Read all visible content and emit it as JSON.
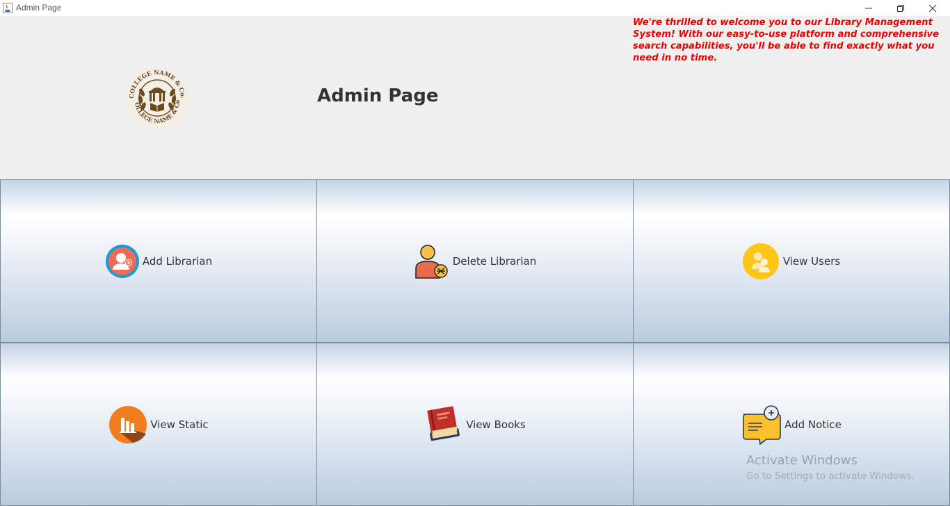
{
  "window": {
    "title": "Admin Page"
  },
  "header": {
    "title": "Admin Page",
    "welcome_text": "We're thrilled to welcome you to our Library Management System! With our easy-to-use platform and comprehensive search capabilities, you'll be able to find exactly what you need in no time.",
    "logo_text": "COLLEGE NAME & Co."
  },
  "tiles": [
    {
      "label": "Add Librarian",
      "icon": "add-user-icon"
    },
    {
      "label": "Delete Librarian",
      "icon": "delete-user-icon"
    },
    {
      "label": "View Users",
      "icon": "users-icon"
    },
    {
      "label": "View Static",
      "icon": "bar-chart-icon"
    },
    {
      "label": "View Books",
      "icon": "books-icon"
    },
    {
      "label": "Add Notice",
      "icon": "notice-icon"
    }
  ],
  "watermark": {
    "title": "Activate Windows",
    "subtitle": "Go to Settings to activate Windows."
  },
  "colors": {
    "welcome": "#ee0000",
    "title": "#333333",
    "tile_border": "#7a8a9c"
  }
}
